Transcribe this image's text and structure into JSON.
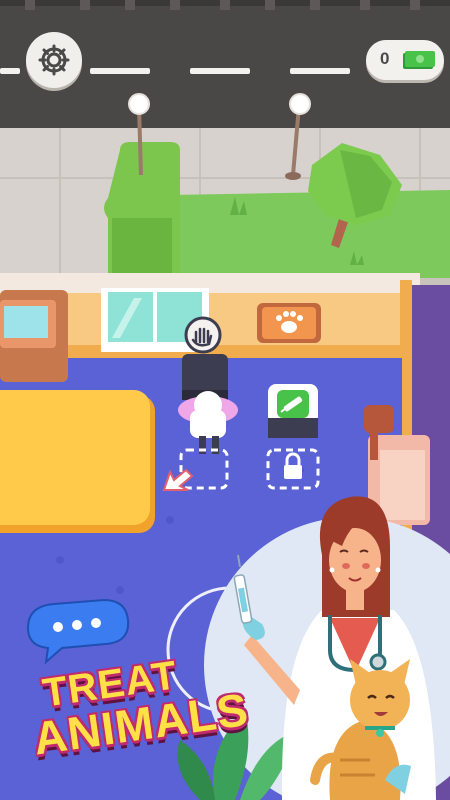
{
  "hud": {
    "cash_value": "0",
    "settings_icon": "gear-icon",
    "cash_icon": "banknote-icon"
  },
  "promo": {
    "line1": "TREAT",
    "line2": "ANIMALS",
    "chat_icon": "chat-bubble-icon"
  },
  "world_icons": {
    "interact": "hand-icon",
    "locked_slot": "lock-icon",
    "syringe_station": "syringe-icon",
    "paw_sign": "paw-icon",
    "direction": "arrow-icon"
  },
  "colors": {
    "accent_yellow": "#ffe147",
    "accent_pink": "#c02a6e",
    "chat_blue": "#3b7cf0",
    "cash_green": "#49c24a",
    "floor_blue": "#5a62d6",
    "grass_green": "#7dc95b"
  }
}
